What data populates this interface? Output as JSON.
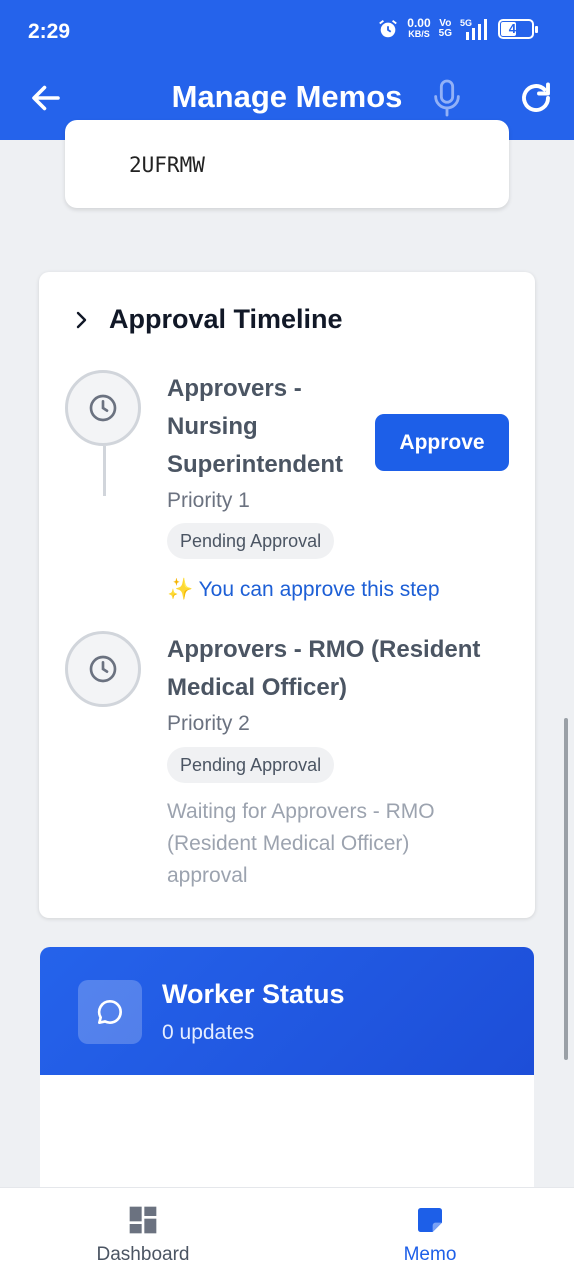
{
  "status": {
    "time": "2:29",
    "net_speed": "0.00",
    "net_unit": "KB/S",
    "volte_top": "Vo",
    "volte_bottom": "5G",
    "signal": "5G",
    "battery": "49"
  },
  "appbar": {
    "title": "Manage Memos"
  },
  "top_card": {
    "code": "2UFRMW"
  },
  "timeline": {
    "title": "Approval Timeline",
    "steps": [
      {
        "title_lines": [
          "Approvers -",
          "Nursing",
          "Superintendent"
        ],
        "priority": "Priority 1",
        "status": "Pending Approval",
        "hint": "✨ You can approve this step",
        "action": "Approve"
      },
      {
        "title_lines": [
          "Approvers - RMO (Resident",
          "Medical Officer)"
        ],
        "priority": "Priority 2",
        "status": "Pending Approval",
        "waiting_lines": [
          "Waiting for Approvers - RMO",
          "(Resident Medical Officer)",
          "approval"
        ]
      }
    ]
  },
  "worker": {
    "title": "Worker Status",
    "subtitle": "0 updates"
  },
  "nav": [
    {
      "label": "Dashboard",
      "icon": "dashboard-icon",
      "active": false
    },
    {
      "label": "Memo",
      "icon": "memo-icon",
      "active": true
    }
  ],
  "colors": {
    "primary": "#2563eb",
    "active_nav": "#1d5fe8",
    "inactive_nav": "#4b5563"
  }
}
